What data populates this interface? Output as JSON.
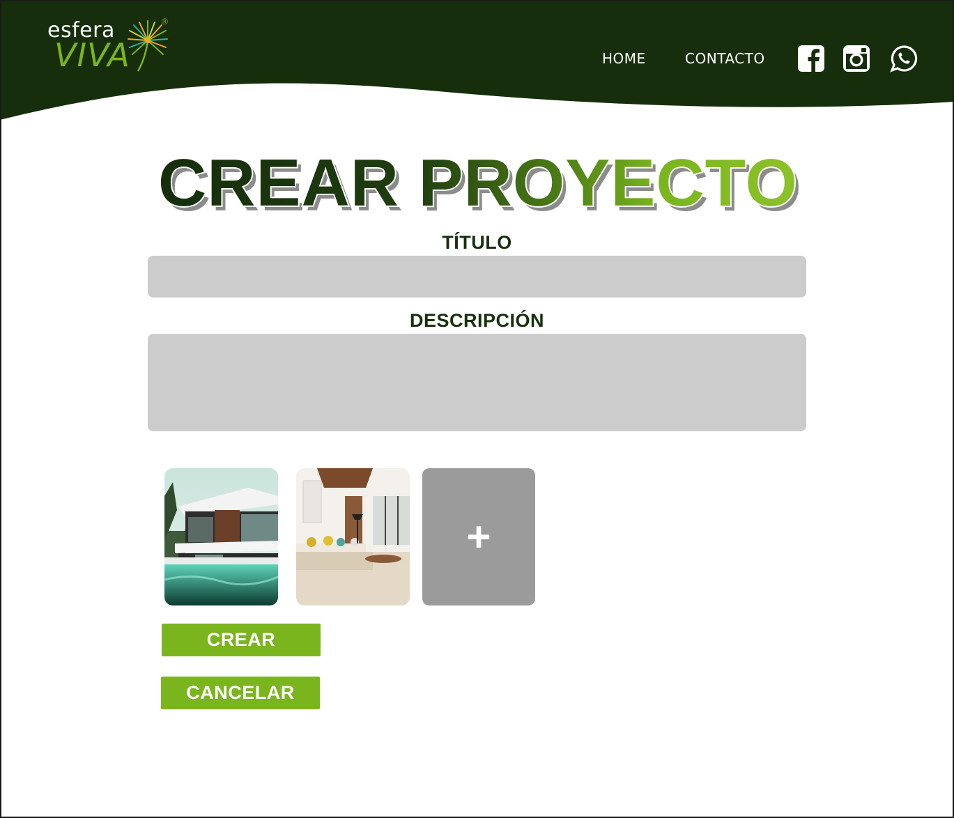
{
  "brand": {
    "logo_text_top": "esfera",
    "logo_text_bottom": "VIVA",
    "registered_mark": "®",
    "primary_color": "#162e0b",
    "accent_color": "#7ab51d"
  },
  "nav": {
    "items": [
      {
        "label": "HOME"
      },
      {
        "label": "CONTACTO"
      }
    ],
    "social": [
      {
        "icon": "facebook-icon"
      },
      {
        "icon": "instagram-icon"
      },
      {
        "icon": "whatsapp-icon"
      }
    ]
  },
  "page": {
    "title": "CREAR PROYECTO"
  },
  "form": {
    "title_label": "TÍTULO",
    "title_value": "",
    "description_label": "DESCRIPCIÓN",
    "description_value": "",
    "images": [
      {
        "icon": "modern-house-pool-photo"
      },
      {
        "icon": "living-room-interior-photo"
      }
    ],
    "add_image_label": "+",
    "create_label": "CREAR",
    "cancel_label": "CANCELAR"
  }
}
